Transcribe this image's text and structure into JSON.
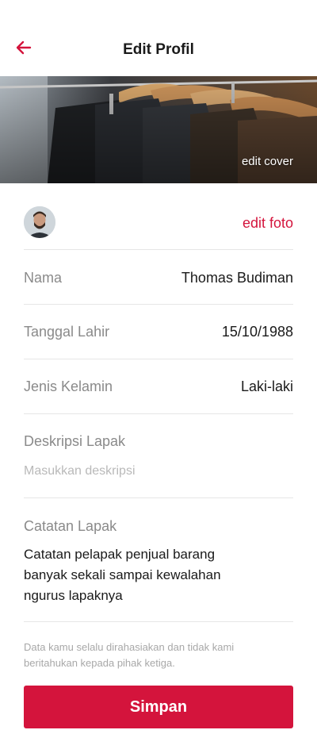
{
  "header": {
    "title": "Edit Profil",
    "back_icon": "arrow-left-icon",
    "accent_color": "#d4143c"
  },
  "cover": {
    "edit_label": "edit cover"
  },
  "photo": {
    "edit_label": "edit foto"
  },
  "fields": {
    "name": {
      "label": "Nama",
      "value": "Thomas Budiman"
    },
    "birth_date": {
      "label": "Tanggal Lahir",
      "value": "15/10/1988"
    },
    "gender": {
      "label": "Jenis Kelamin",
      "value": "Laki-laki"
    },
    "description": {
      "label": "Deskripsi Lapak",
      "placeholder": "Masukkan deskripsi"
    },
    "notes": {
      "label": "Catatan Lapak",
      "line1": "Catatan pelapak penjual barang",
      "line2": "banyak sekali sampai kewalahan",
      "line3": "ngurus lapaknya"
    }
  },
  "privacy": {
    "line1": "Data kamu selalu dirahasiakan dan tidak kami",
    "line2": "beritahukan kepada pihak ketiga."
  },
  "actions": {
    "save_label": "Simpan"
  }
}
